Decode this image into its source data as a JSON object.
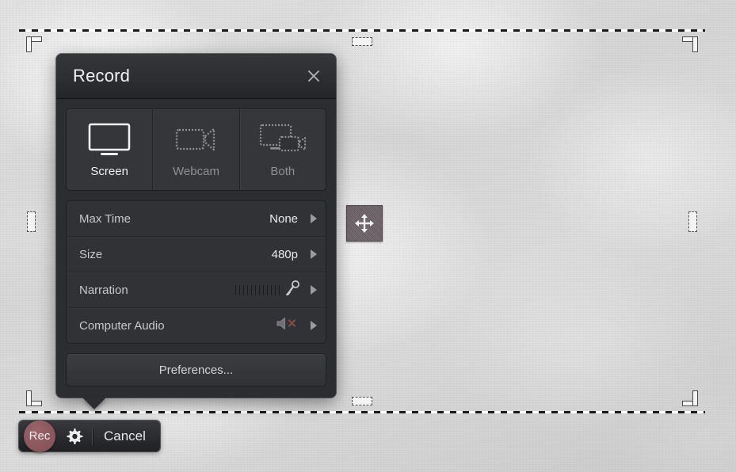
{
  "dialog": {
    "title": "Record",
    "close_icon": "close-icon",
    "modes": [
      {
        "label": "Screen",
        "icon": "monitor-icon",
        "selected": true
      },
      {
        "label": "Webcam",
        "icon": "webcam-icon",
        "selected": false
      },
      {
        "label": "Both",
        "icon": "screen-and-webcam-icon",
        "selected": false
      }
    ],
    "settings": [
      {
        "label": "Max Time",
        "value": "None",
        "extra": "none",
        "chevron": "chevron-right-icon"
      },
      {
        "label": "Size",
        "value": "480p",
        "extra": "none",
        "chevron": "chevron-right-icon"
      },
      {
        "label": "Narration",
        "value": "",
        "extra": "level-meter-and-microphone",
        "chevron": "chevron-right-icon"
      },
      {
        "label": "Computer Audio",
        "value": "",
        "extra": "speaker-muted",
        "chevron": "chevron-right-icon"
      }
    ],
    "preferences_label": "Preferences...",
    "meter_bar_count": 12
  },
  "toolbar": {
    "rec_label": "Rec",
    "gear_icon": "gear-icon",
    "cancel_label": "Cancel"
  },
  "selection": {
    "move_handle_icon": "move-arrows-icon",
    "corner_handles": [
      "top-left",
      "top-right",
      "bottom-left",
      "bottom-right"
    ],
    "edge_handles": [
      "top",
      "bottom",
      "left",
      "right"
    ]
  },
  "colors": {
    "dialog_background": "#2b2d30",
    "titlebar_background": "#35373a",
    "row_background": "#303235",
    "rec_red": "#8b585d",
    "mute_red": "#8a4a4a",
    "text_primary": "#f0f0f0",
    "text_secondary": "#8d9094",
    "desktop": "#d6d6d6"
  }
}
